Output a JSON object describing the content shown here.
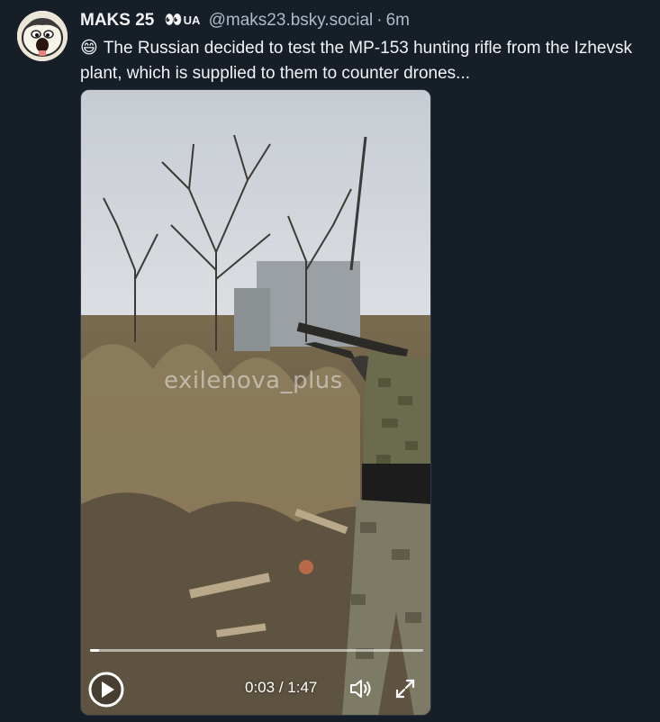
{
  "post": {
    "author": {
      "display_name": "MAKS 25",
      "badge_emoji": "👀",
      "badge_text": "UA",
      "handle": "@maks23.bsky.social",
      "separator": "·",
      "timestamp": "6m",
      "avatar_icon": "cartoon-face-avatar"
    },
    "text_emoji": "😄",
    "text": "The Russian decided to test the MP-153 hunting rifle from the Izhevsk plant, which is supplied to them to counter drones..."
  },
  "video": {
    "watermark": "exilenova_plus",
    "current_time": "0:03",
    "time_separator": "/",
    "duration": "1:47",
    "progress_fraction": 0.028,
    "controls": {
      "play_icon": "play-icon",
      "volume_icon": "volume-icon",
      "fullscreen_icon": "fullscreen-icon"
    }
  },
  "colors": {
    "background": "#161e27",
    "text": "#f1f3f5",
    "muted": "#aebbc9"
  }
}
